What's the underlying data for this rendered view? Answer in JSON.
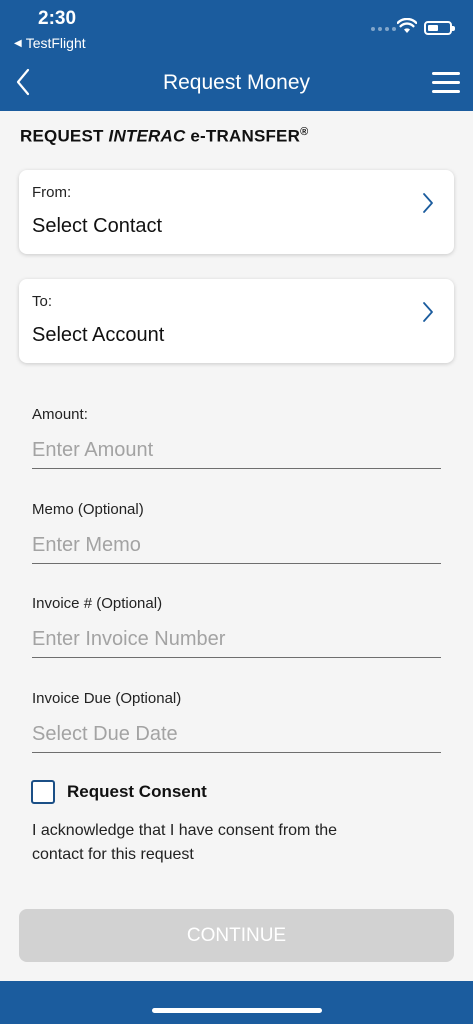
{
  "status_bar": {
    "time": "2:30",
    "back_app": "TestFlight",
    "icons": [
      "wifi-icon",
      "battery-icon"
    ]
  },
  "nav": {
    "title": "Request Money",
    "back_icon": "chevron-left-icon",
    "menu_icon": "hamburger-menu-icon"
  },
  "section": {
    "title_prefix": "REQUEST ",
    "title_brand": "INTERAC",
    "title_suffix": " e-TRANSFER",
    "title_mark": "®"
  },
  "from_card": {
    "label": "From:",
    "value": "Select Contact"
  },
  "to_card": {
    "label": "To:",
    "value": "Select Account"
  },
  "fields": {
    "amount": {
      "label": "Amount:",
      "placeholder": "Enter Amount"
    },
    "memo": {
      "label": "Memo (Optional)",
      "placeholder": "Enter Memo"
    },
    "invoice_number": {
      "label": "Invoice # (Optional)",
      "placeholder": "Enter Invoice Number"
    },
    "invoice_due": {
      "label": "Invoice Due (Optional)",
      "placeholder": "Select Due Date"
    }
  },
  "consent": {
    "label": "Request Consent",
    "checked": false,
    "text": "I acknowledge that I have consent from the contact for this request"
  },
  "continue_label": "CONTINUE",
  "colors": {
    "brand_blue": "#1b5c9e",
    "background": "#f5f5f5",
    "button_disabled": "#d2d2d2",
    "checkbox_border": "#1b4f86"
  }
}
